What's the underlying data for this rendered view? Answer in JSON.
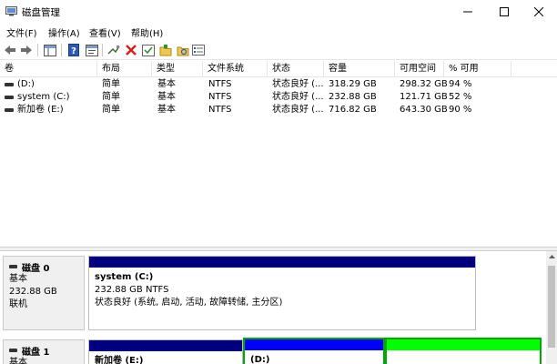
{
  "window": {
    "title": "磁盘管理"
  },
  "menu": [
    "文件(F)",
    "操作(A)",
    "查看(V)",
    "帮助(H)"
  ],
  "toolbar": {
    "icons": [
      "back-arrow-icon",
      "forward-arrow-icon",
      "show-hide-console-tree-icon",
      "help-icon",
      "properties-icon",
      "connect-icon",
      "delete-icon",
      "check-icon",
      "folder-icon",
      "search-folder-icon",
      "list-icon"
    ]
  },
  "table": {
    "columns": [
      "卷",
      "布局",
      "类型",
      "文件系统",
      "状态",
      "容量",
      "可用空间",
      "% 可用"
    ],
    "rows": [
      [
        "(D:)",
        "简单",
        "基本",
        "NTFS",
        "状态良好 (...",
        "318.29 GB",
        "298.32 GB",
        "94 %"
      ],
      [
        "system (C:)",
        "简单",
        "基本",
        "NTFS",
        "状态良好 (...",
        "232.88 GB",
        "121.71 GB",
        "52 %"
      ],
      [
        "新加卷 (E:)",
        "简单",
        "基本",
        "NTFS",
        "状态良好 (...",
        "716.82 GB",
        "643.30 GB",
        "90 %"
      ]
    ]
  },
  "disks": [
    {
      "name": "磁盘 0",
      "type": "基本",
      "size": "232.88 GB",
      "status": "联机",
      "partitions": [
        {
          "name": "system  (C:)",
          "size": "232.88 GB NTFS",
          "status": "状态良好 (系统, 启动, 活动, 故障转储, 主分区)"
        }
      ]
    },
    {
      "name": "磁盘 1",
      "type": "基本",
      "partitions": [
        {
          "name": "新加卷  (E:)"
        },
        {
          "name": "(D:)"
        },
        {
          "name": ""
        }
      ]
    }
  ],
  "colors": {
    "primary_partition": "#00007f",
    "logical_drive": "#0000ff",
    "free_space": "#00ff00",
    "selected_border": "#00aa00"
  }
}
